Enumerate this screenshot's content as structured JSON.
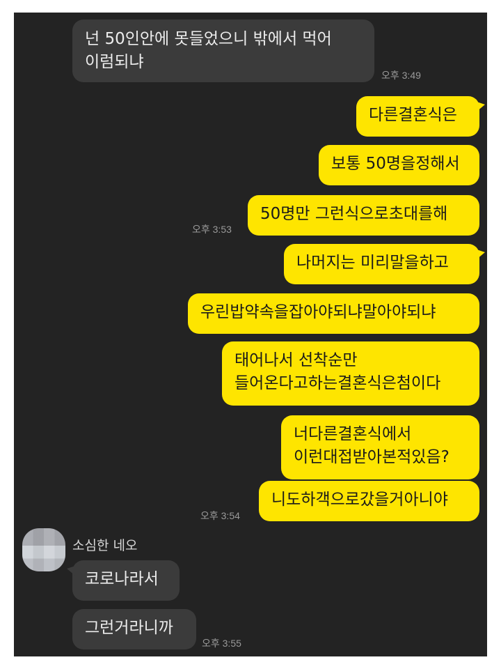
{
  "messages": [
    {
      "id": "m1",
      "lines": [
        "넌 50인안에 못들었으니 밖에서 먹어",
        "이럼되냐"
      ]
    },
    {
      "id": "m2",
      "lines": [
        "다른결혼식은"
      ]
    },
    {
      "id": "m3",
      "lines": [
        "보통 50명을정해서"
      ]
    },
    {
      "id": "m4",
      "lines": [
        "50명만 그런식으로초대를해"
      ]
    },
    {
      "id": "m5",
      "lines": [
        "나머지는 미리말을하고"
      ]
    },
    {
      "id": "m6",
      "lines": [
        "우린밥약속을잡아야되냐말아야되냐"
      ]
    },
    {
      "id": "m7",
      "lines": [
        "태어나서 선착순만",
        "들어온다고하는결혼식은첨이다"
      ]
    },
    {
      "id": "m8",
      "lines": [
        "너다른결혼식에서",
        "이런대접받아본적있음?"
      ]
    },
    {
      "id": "m9",
      "lines": [
        "니도하객으로갔을거아니야"
      ]
    },
    {
      "id": "m10",
      "lines": [
        "코로나라서"
      ]
    },
    {
      "id": "m11",
      "lines": [
        "그런거라니까"
      ]
    }
  ],
  "times": {
    "t1": "오후 3:49",
    "t2": "오후 3:53",
    "t3": "오후 3:54",
    "t4": "오후 3:55"
  },
  "sender": {
    "name": "소심한 네오"
  },
  "colors": {
    "background": "#232323",
    "outgoing_bubble": "#fee500",
    "incoming_bubble": "#3b3b3b"
  }
}
